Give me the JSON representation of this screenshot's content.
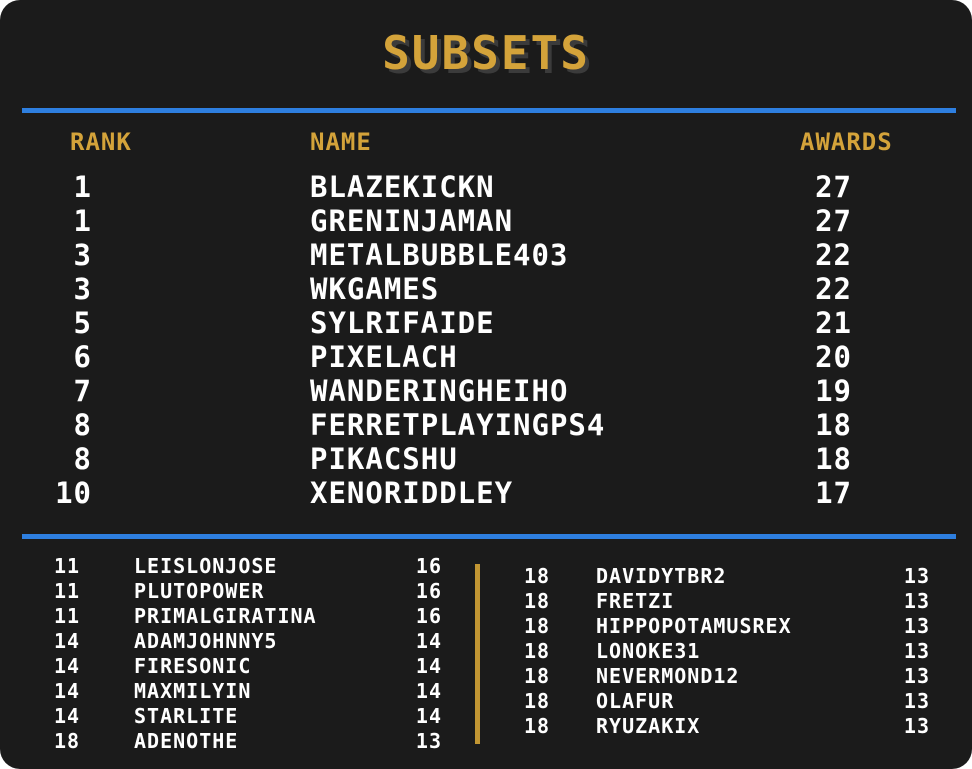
{
  "title": "SUBSETS",
  "headers": {
    "rank": "RANK",
    "name": "NAME",
    "awards": "AWARDS"
  },
  "colors": {
    "accent": "#d4a33a",
    "rule": "#2e7fe0",
    "background": "#1b1b1b",
    "text": "#ffffff"
  },
  "top": [
    {
      "rank": "1",
      "name": "BLAZEKICKN",
      "awards": "27"
    },
    {
      "rank": "1",
      "name": "GRENINJAMAN",
      "awards": "27"
    },
    {
      "rank": "3",
      "name": "METALBUBBLE403",
      "awards": "22"
    },
    {
      "rank": "3",
      "name": "WKGAMES",
      "awards": "22"
    },
    {
      "rank": "5",
      "name": "SYLRIFAIDE",
      "awards": "21"
    },
    {
      "rank": "6",
      "name": "PIXELACH",
      "awards": "20"
    },
    {
      "rank": "7",
      "name": "WANDERINGHEIHO",
      "awards": "19"
    },
    {
      "rank": "8",
      "name": "FERRETPLAYINGPS4",
      "awards": "18"
    },
    {
      "rank": "8",
      "name": "PIKACSHU",
      "awards": "18"
    },
    {
      "rank": "10",
      "name": "XENORIDDLEY",
      "awards": "17"
    }
  ],
  "left": [
    {
      "rank": "11",
      "name": "LEISLONJOSE",
      "awards": "16"
    },
    {
      "rank": "11",
      "name": "PLUTOPOWER",
      "awards": "16"
    },
    {
      "rank": "11",
      "name": "PRIMALGIRATINA",
      "awards": "16"
    },
    {
      "rank": "14",
      "name": "ADAMJOHNNY5",
      "awards": "14"
    },
    {
      "rank": "14",
      "name": "FIRESONIC",
      "awards": "14"
    },
    {
      "rank": "14",
      "name": "MAXMILYIN",
      "awards": "14"
    },
    {
      "rank": "14",
      "name": "STARLITE",
      "awards": "14"
    },
    {
      "rank": "18",
      "name": "ADENOTHE",
      "awards": "13"
    }
  ],
  "right": [
    {
      "rank": "18",
      "name": "DAVIDYTBR2",
      "awards": "13"
    },
    {
      "rank": "18",
      "name": "FRETZI",
      "awards": "13"
    },
    {
      "rank": "18",
      "name": "HIPPOPOTAMUSREX",
      "awards": "13"
    },
    {
      "rank": "18",
      "name": "LONOKE31",
      "awards": "13"
    },
    {
      "rank": "18",
      "name": "NEVERMOND12",
      "awards": "13"
    },
    {
      "rank": "18",
      "name": "OLAFUR",
      "awards": "13"
    },
    {
      "rank": "18",
      "name": "RYUZAKIX",
      "awards": "13"
    }
  ]
}
